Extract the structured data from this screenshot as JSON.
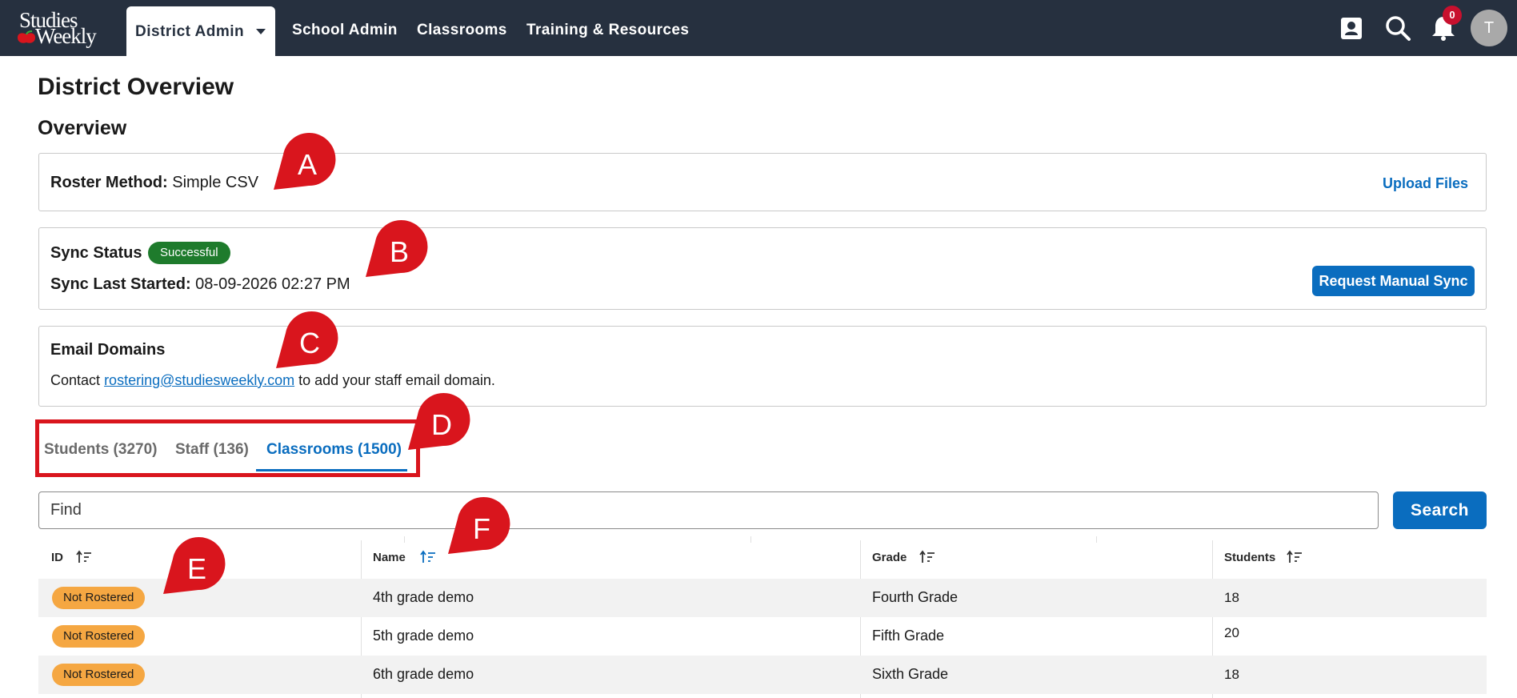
{
  "nav": {
    "logo_line1": "Studies",
    "logo_line2": "Weekly",
    "active_tab": "District Admin",
    "links": [
      "School Admin",
      "Classrooms",
      "Training & Resources"
    ],
    "notification_count": "0",
    "avatar_initial": "T",
    "icons": [
      "contact-card-icon",
      "search-icon",
      "bell-icon"
    ]
  },
  "page": {
    "title": "District Overview",
    "section": "Overview"
  },
  "roster": {
    "label": "Roster Method:",
    "value": "Simple CSV",
    "action": "Upload Files"
  },
  "sync": {
    "label": "Sync Status",
    "status": "Successful",
    "last_label": "Sync Last Started:",
    "last_value": "08-09-2026 02:27 PM",
    "action": "Request Manual Sync"
  },
  "email": {
    "heading": "Email Domains",
    "prefix": "Contact",
    "link": "rostering@studiesweekly.com",
    "suffix": "to add your staff email domain."
  },
  "tabs": [
    {
      "label": "Students (3270)",
      "active": false
    },
    {
      "label": "Staff (136)",
      "active": false
    },
    {
      "label": "Classrooms (1500)",
      "active": true
    }
  ],
  "search": {
    "placeholder": "Find",
    "button": "Search"
  },
  "table": {
    "columns": [
      "ID",
      "Name",
      "Grade",
      "Students"
    ],
    "rows": [
      {
        "id": "Not Rostered",
        "name": "4th grade demo",
        "grade": "Fourth Grade",
        "students": "18"
      },
      {
        "id": "Not Rostered",
        "name": "5th grade demo",
        "grade": "Fifth Grade",
        "students": "20"
      },
      {
        "id": "Not Rostered",
        "name": "6th grade demo",
        "grade": "Sixth Grade",
        "students": "18"
      }
    ]
  },
  "annotations": [
    "A",
    "B",
    "C",
    "D",
    "E",
    "F"
  ],
  "colors": {
    "nav_bg": "#26303f",
    "accent": "#0a6dbf",
    "success": "#1e7b2c",
    "warning": "#f5a742",
    "annotation_red": "#d9151d"
  }
}
